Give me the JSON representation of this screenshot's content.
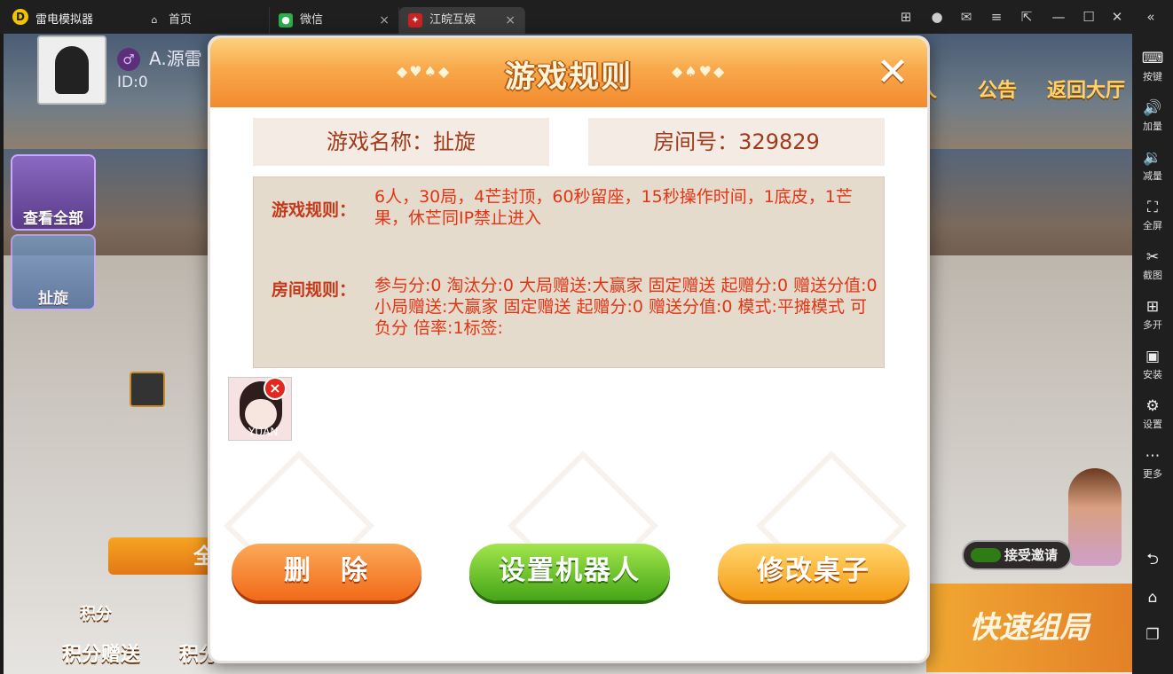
{
  "window": {
    "app_name": "雷电模拟器",
    "tabs": [
      {
        "label": "首页",
        "icon": "home-icon"
      },
      {
        "label": "微信",
        "icon": "wechat-icon"
      },
      {
        "label": "江皖互娱",
        "icon": "game-app-icon"
      }
    ],
    "close_glyph": "×"
  },
  "sidebar": {
    "items": [
      {
        "label": "按键",
        "icon": "keyboard-icon"
      },
      {
        "label": "加量",
        "icon": "volume-up-icon"
      },
      {
        "label": "减量",
        "icon": "volume-down-icon"
      },
      {
        "label": "全屏",
        "icon": "fullscreen-icon"
      },
      {
        "label": "截图",
        "icon": "scissors-icon"
      },
      {
        "label": "多开",
        "icon": "multi-instance-icon"
      },
      {
        "label": "安装",
        "icon": "apk-icon"
      },
      {
        "label": "设置",
        "icon": "gear-icon"
      },
      {
        "label": "更多",
        "icon": "more-icon"
      }
    ]
  },
  "game": {
    "player_name": "A.源雷",
    "player_id": "ID:0",
    "top_icons": [
      "人",
      "公告",
      "返回大厅"
    ],
    "left_buttons": [
      "查看全部",
      "扯旋"
    ],
    "bottom_items": [
      "积分赠送",
      "积分"
    ],
    "bottom_caption": "积分",
    "orange_bar_label": "全",
    "invite_label": "接受邀请",
    "quick_label": "快速组局"
  },
  "dialog": {
    "title": "游戏规则",
    "deco_left": "◆♥♠◆",
    "deco_right": "◆♠♥◆",
    "game_name": "游戏名称：扯旋",
    "room_no": "房间号：329829",
    "game_rules_label": "游戏规则：",
    "game_rules_text": "6人，30局，4芒封顶，60秒留座，15秒操作时间，1底皮，1芒果，休芒同IP禁止进入",
    "room_rules_label": "房间规则：",
    "room_rules_text": "参与分:0 淘汰分:0 大局赠送:大赢家 固定赠送 起赠分:0 赠送分值:0 小局赠送:大赢家 固定赠送  起赠分:0 赠送分值:0 模式:平摊模式 可负分 倍率:1标签:",
    "bot_name": "YUAN",
    "buttons": {
      "delete": "删　除",
      "set_robot": "设置机器人",
      "modify_table": "修改桌子"
    }
  }
}
